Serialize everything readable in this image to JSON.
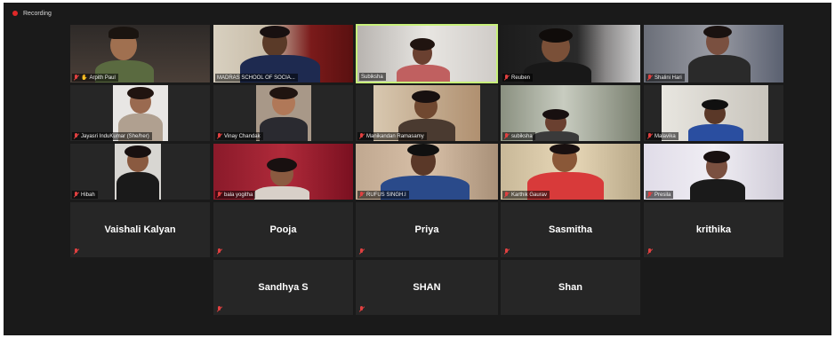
{
  "status": {
    "recording_label": "Recording"
  },
  "participants_video": [
    {
      "name": "Arpith Paul",
      "hand_raised": true
    },
    {
      "name": "MADRAS SCHOOL OF SOCIA..."
    },
    {
      "name": "Subiksha",
      "active_speaker": true
    },
    {
      "name": "Reuben"
    },
    {
      "name": "Shalini Hari"
    },
    {
      "name": "Jayasri InduKumar (She/her)"
    },
    {
      "name": "Vinay Chandak"
    },
    {
      "name": "Manikandan Ramasamy"
    },
    {
      "name": "subiksha"
    },
    {
      "name": "Malavika"
    },
    {
      "name": "Hibah"
    },
    {
      "name": "bala yogitha"
    },
    {
      "name": "RUFUS SINGH.I"
    },
    {
      "name": "Karthik Gaurav"
    },
    {
      "name": "Presila"
    }
  ],
  "participants_audio": [
    {
      "name": "Vaishali Kalyan"
    },
    {
      "name": "Pooja"
    },
    {
      "name": "Priya"
    },
    {
      "name": "Sasmitha"
    },
    {
      "name": "krithika"
    },
    {
      "name": "Sandhya S"
    },
    {
      "name": "SHAN"
    },
    {
      "name": "Shan"
    }
  ],
  "colors": {
    "background": "#1a1a1a",
    "tile": "#262626",
    "active_border": "#c8f07a",
    "muted_mic": "#e04040",
    "recording_dot": "#e02828"
  }
}
